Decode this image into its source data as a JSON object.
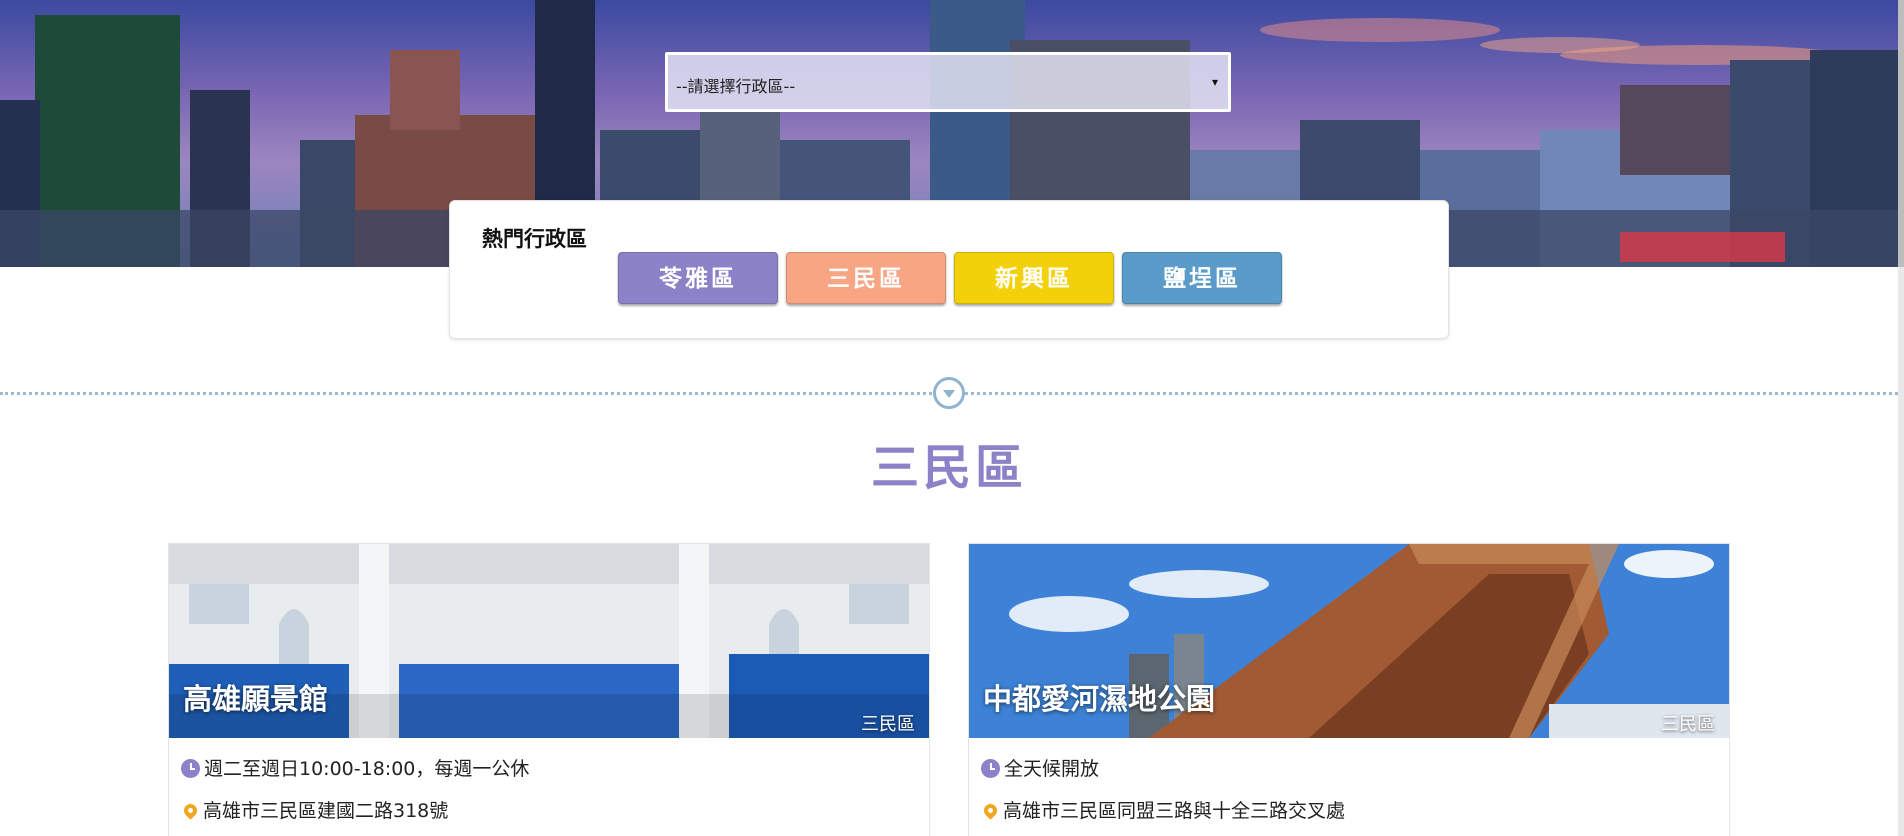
{
  "select": {
    "placeholder": "--請選擇行政區--",
    "caret": "▾"
  },
  "popular": {
    "title": "熱門行政區",
    "buttons": [
      {
        "label": "苓雅區",
        "color": "#8c82c8"
      },
      {
        "label": "三民區",
        "color": "#f8a583"
      },
      {
        "label": "新興區",
        "color": "#f3d10a"
      },
      {
        "label": "鹽埕區",
        "color": "#5a9bc9"
      }
    ]
  },
  "section": {
    "title": "三民區"
  },
  "cards": [
    {
      "name": "高雄願景館",
      "district": "三民區",
      "hours": "週二至週日10:00-18:00，每週一公休",
      "address": "高雄市三民區建國二路318號"
    },
    {
      "name": "中都愛河濕地公園",
      "district": "三民區",
      "hours": "全天候開放",
      "address": "高雄市三民區同盟三路與十全三路交叉處"
    }
  ],
  "colors": {
    "accent": "#8c82c8",
    "divider": "#9bbbd3",
    "pin": "#f1a621"
  }
}
